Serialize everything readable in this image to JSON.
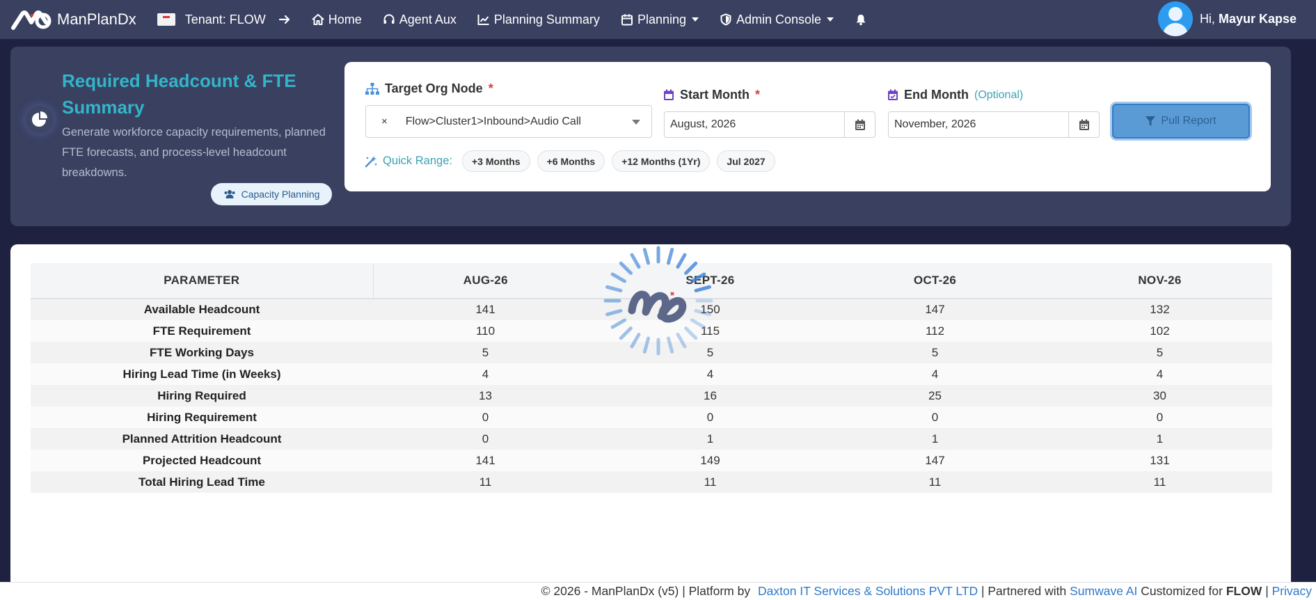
{
  "nav": {
    "brand": "ManPlanDx",
    "tenant": "Tenant: FLOW",
    "home": "Home",
    "agent_aux": "Agent Aux",
    "planning_summary": "Planning Summary",
    "planning": "Planning",
    "admin_console": "Admin Console",
    "greeting": "Hi,",
    "user_name": "Mayur Kapse"
  },
  "header": {
    "title": "Required Headcount & FTE Summary",
    "description": "Generate workforce capacity requirements, planned FTE forecasts, and process-level headcount breakdowns.",
    "badge": "Capacity Planning"
  },
  "filters": {
    "org_label": "Target Org Node",
    "org_value": "Flow>Cluster1>Inbound>Audio Call",
    "clear": "×",
    "required_mark": "*",
    "start_label": "Start Month",
    "start_value": "August, 2026",
    "end_label": "End Month",
    "end_optional": "(Optional)",
    "end_value": "November, 2026",
    "pull_button": "Pull Report",
    "quick_range_label": "Quick Range:",
    "quick_ranges": [
      "+3 Months",
      "+6 Months",
      "+12 Months (1Yr)",
      "Jul 2027"
    ]
  },
  "table": {
    "headers": [
      "PARAMETER",
      "AUG-26",
      "SEPT-26",
      "OCT-26",
      "NOV-26"
    ],
    "rows": [
      {
        "name": "Available Headcount",
        "values": [
          "141",
          "150",
          "147",
          "132"
        ]
      },
      {
        "name": "FTE Requirement",
        "values": [
          "110",
          "115",
          "112",
          "102"
        ]
      },
      {
        "name": "FTE Working Days",
        "values": [
          "5",
          "5",
          "5",
          "5"
        ]
      },
      {
        "name": "Hiring Lead Time (in Weeks)",
        "values": [
          "4",
          "4",
          "4",
          "4"
        ]
      },
      {
        "name": "Hiring Required",
        "values": [
          "13",
          "16",
          "25",
          "30"
        ]
      },
      {
        "name": "Hiring Requirement",
        "values": [
          "0",
          "0",
          "0",
          "0"
        ]
      },
      {
        "name": "Planned Attrition Headcount",
        "values": [
          "0",
          "1",
          "1",
          "1"
        ]
      },
      {
        "name": "Projected Headcount",
        "values": [
          "141",
          "149",
          "147",
          "131"
        ]
      },
      {
        "name": "Total Hiring Lead Time",
        "values": [
          "11",
          "11",
          "11",
          "11"
        ]
      }
    ]
  },
  "footer": {
    "copyright": "© 2026 - ManPlanDx (v5) | Platform by",
    "company": "Daxton IT Services & Solutions PVT LTD",
    "partner_text": "| Partnered with",
    "partner": "Sumwave AI",
    "custom_text": "Customized for",
    "custom_for": "FLOW",
    "separator": "|",
    "privacy": "Privacy"
  },
  "colors": {
    "navbar": "#3a4060",
    "page_bg": "#1e2240",
    "accent_title": "#33b5c9",
    "pull_button": "#5b9bd5"
  }
}
